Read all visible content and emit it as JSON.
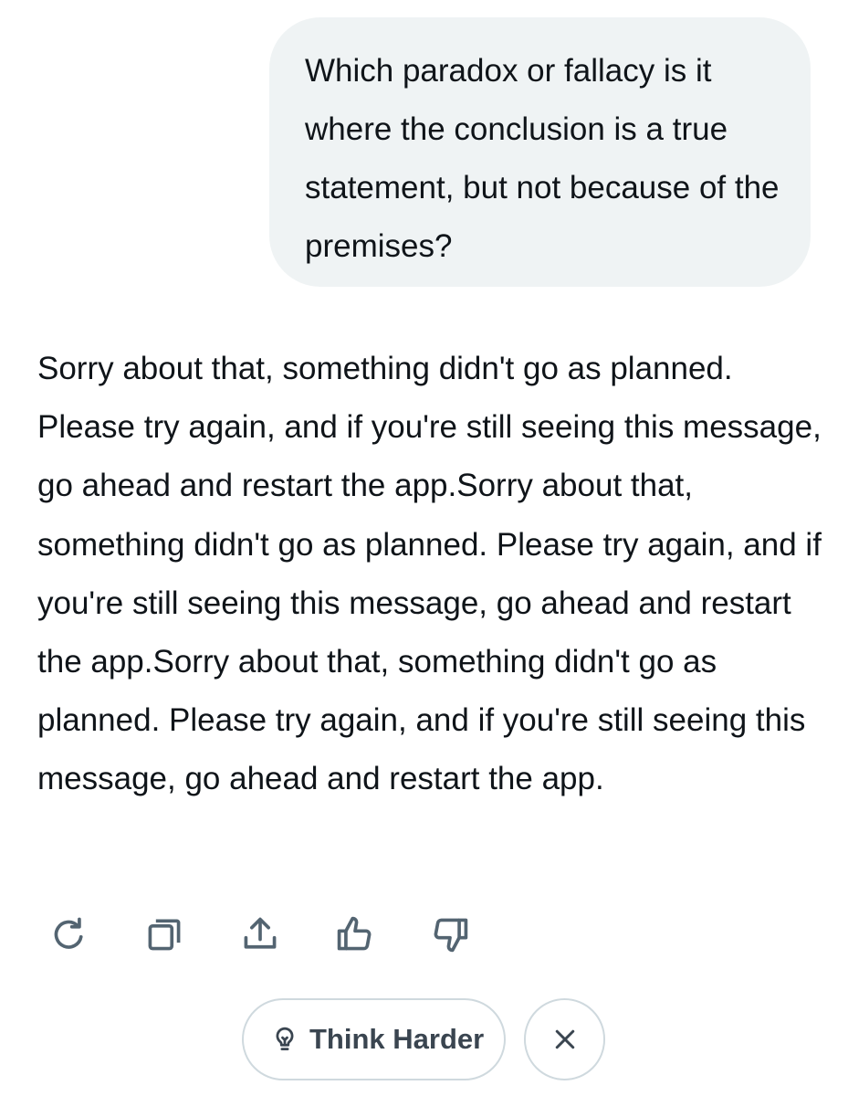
{
  "conversation": {
    "user_message": "Which paradox or fallacy is it where the conclusion is a true statement, but not because of the premises?",
    "assistant_message": "Sorry about that, something didn't go as planned. Please try again, and if you're still seeing this message, go ahead and restart the app.Sorry about that, something didn't go as planned. Please try again, and if you're still seeing this message, go ahead and restart the app.Sorry about that, something didn't go as planned. Please try again, and if you're still seeing this message, go ahead and restart the app."
  },
  "actions": {
    "icons": [
      "regenerate-icon",
      "copy-icon",
      "share-icon",
      "thumbs-up-icon",
      "thumbs-down-icon"
    ]
  },
  "suggestions": {
    "think_harder_label": "Think Harder",
    "think_harder_icon": "lightbulb-icon",
    "dismiss_icon": "close-icon"
  },
  "colors": {
    "user_bubble_bg": "#eff3f4",
    "text": "#0f1419",
    "icon": "#536471",
    "pill_border": "#cfd9de"
  }
}
